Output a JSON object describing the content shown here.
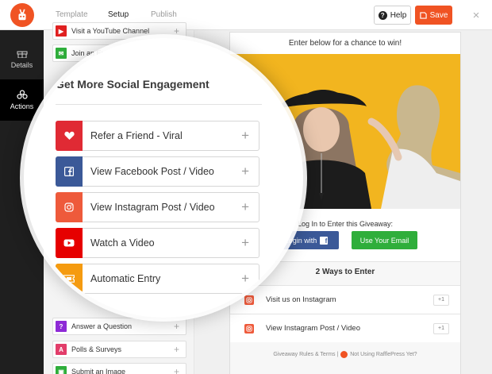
{
  "header": {
    "tabs": [
      {
        "label": "Template"
      },
      {
        "label": "Setup"
      },
      {
        "label": "Publish"
      }
    ],
    "help_label": "Help",
    "save_label": "Save",
    "close_glyph": "×"
  },
  "rail": {
    "items": [
      {
        "label": "Details",
        "icon": "gift-icon"
      },
      {
        "label": "Actions",
        "icon": "actions-icon"
      }
    ]
  },
  "sidebar": {
    "items_top": [
      {
        "label": "Visit a YouTube Channel",
        "color": "#e02020"
      },
      {
        "label": "Join an Email Newsletter",
        "color": "#2fae3b"
      }
    ],
    "items_bottom": [
      {
        "label": "Answer a Question",
        "color": "#8e2ad6"
      },
      {
        "label": "Polls & Surveys",
        "color": "#e23d6a"
      },
      {
        "label": "Submit an Image",
        "color": "#2fae3b"
      }
    ]
  },
  "magnifier": {
    "title": "Get More Social Engagement",
    "items": [
      {
        "label": "Refer a Friend - Viral",
        "color": "#e02a34",
        "icon": "heart-icon"
      },
      {
        "label": "View Facebook Post / Video",
        "color": "#3b5998",
        "icon": "facebook-icon"
      },
      {
        "label": "View Instagram Post / Video",
        "color": "#ee5a3b",
        "icon": "instagram-icon"
      },
      {
        "label": "Watch a Video",
        "color": "#e60000",
        "icon": "youtube-icon"
      },
      {
        "label": "Automatic Entry",
        "color": "#f59b10",
        "icon": "ticket-icon"
      }
    ]
  },
  "preview": {
    "heading": "Enter below for a chance to win!",
    "login_text": "Log In to Enter this Giveaway:",
    "fb_button": "Login with",
    "email_button": "Use Your Email",
    "ways_title": "2 Ways to Enter",
    "entries": [
      {
        "label": "Visit us on Instagram",
        "points": "+1"
      },
      {
        "label": "View Instagram Post / Video",
        "points": "+1"
      }
    ],
    "footer": "Giveaway Rules & Terms |",
    "footer_right": "Not Using RafflePress Yet?"
  },
  "colors": {
    "accent": "#f05323",
    "rail_bg": "#1f1f1f",
    "image_bg": "#f2b51f"
  }
}
